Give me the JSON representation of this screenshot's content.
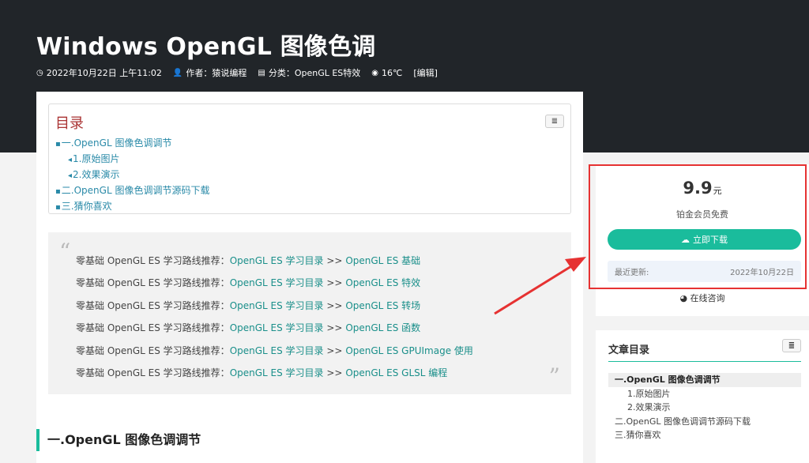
{
  "header": {
    "title": "Windows OpenGL 图像色调",
    "date": "2022年10月22日 上午11:02",
    "author": "作者：猿说编程",
    "category": "分类：OpenGL ES特效",
    "views": "16℃",
    "edit": "[编辑]"
  },
  "toc": {
    "title": "目录",
    "items": [
      {
        "text": "一.OpenGL 图像色调调节",
        "level": 1
      },
      {
        "text": "1.原始图片",
        "level": 2
      },
      {
        "text": "2.效果演示",
        "level": 2
      },
      {
        "text": "二.OpenGL 图像色调调节源码下载",
        "level": 1
      },
      {
        "text": "三.猜你喜欢",
        "level": 1
      }
    ]
  },
  "quote": {
    "prefix": "零基础 OpenGL ES 学习路线推荐：",
    "lines": [
      {
        "link1": "OpenGL ES 学习目录",
        "sep": " >> ",
        "link2": "OpenGL ES 基础"
      },
      {
        "link1": "OpenGL ES 学习目录",
        "sep": "  >> ",
        "link2": "OpenGL ES 特效"
      },
      {
        "link1": "OpenGL ES 学习目录",
        "sep": "  >> ",
        "link2": "OpenGL ES 转场"
      },
      {
        "link1": "OpenGL ES 学习目录",
        "sep": " >> ",
        "link2": "OpenGL ES 函数"
      },
      {
        "link1": "OpenGL ES 学习目录",
        "sep": " >> ",
        "link2": "OpenGL ES GPUImage 使用"
      },
      {
        "link1": "OpenGL ES 学习目录",
        "sep": " >> ",
        "link2": "OpenGL ES GLSL 编程"
      }
    ]
  },
  "section": {
    "heading": "一.OpenGL 图像色调调节"
  },
  "sidebar": {
    "price": "9.9",
    "price_unit": "元",
    "price_note": "铂金会员免费",
    "download_label": "立即下载",
    "update_label": "最近更新:",
    "update_date": "2022年10月22日",
    "consult_label": "在线咨询",
    "toc_title": "文章目录",
    "toc_items": [
      {
        "text": "一.OpenGL 图像色调调节",
        "level": 1,
        "active": true
      },
      {
        "text": "1.原始图片",
        "level": 2
      },
      {
        "text": "2.效果演示",
        "level": 2
      },
      {
        "text": "二.OpenGL 图像色调调节源码下载",
        "level": 1
      },
      {
        "text": "三.猜你喜欢",
        "level": 1
      }
    ]
  },
  "colors": {
    "accent": "#1abc9c",
    "highlight_border": "#e63232",
    "header_bg": "#212529"
  }
}
